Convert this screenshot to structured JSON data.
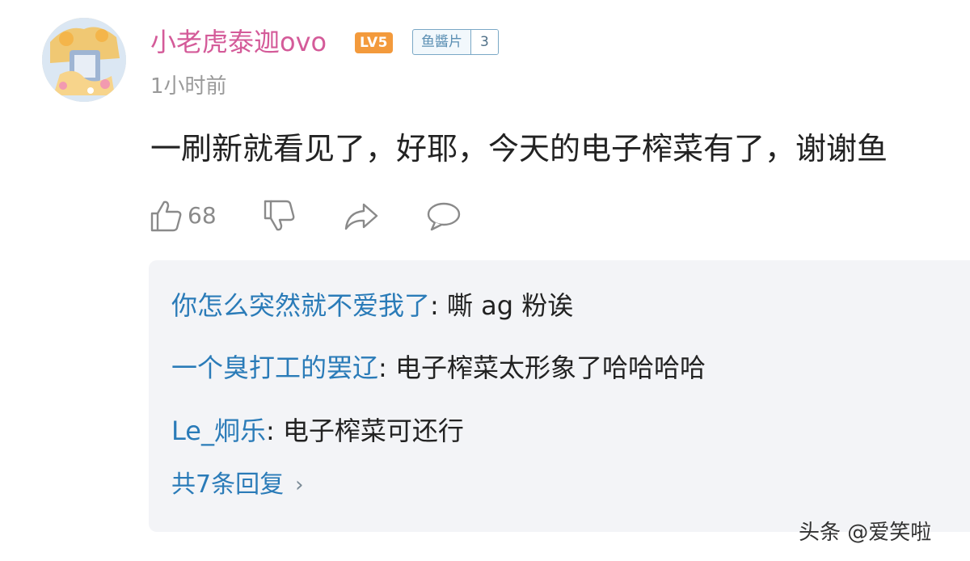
{
  "comment": {
    "username": "小老虎泰迦ovo",
    "level_badge": "LV5",
    "fan_badge": {
      "name": "鱼醬片",
      "level": "3"
    },
    "time": "1小时前",
    "text": "一刷新就看见了，好耶，今天的电子榨菜有了，谢谢鱼",
    "actions": {
      "like_count": "68",
      "like_icon": "thumbs-up-icon",
      "dislike_icon": "thumbs-down-icon",
      "share_icon": "share-icon",
      "comment_icon": "comment-icon"
    }
  },
  "replies": [
    {
      "name": "你怎么突然就不爱我了",
      "sep": ": ",
      "text": "嘶 ag 粉诶"
    },
    {
      "name": "一个臭打工的罢辽",
      "sep": ": ",
      "text": "电子榨菜太形象了哈哈哈哈"
    },
    {
      "name": "Le_炯乐",
      "sep": ": ",
      "text": "电子榨菜可还行"
    }
  ],
  "more_replies": "共7条回复",
  "watermark": "头条 @爱笑啦",
  "colors": {
    "username": "#d45b99",
    "reply_name": "#2a7bb8",
    "level_badge": "#f39a3c",
    "reply_bg": "#f3f4f7"
  }
}
